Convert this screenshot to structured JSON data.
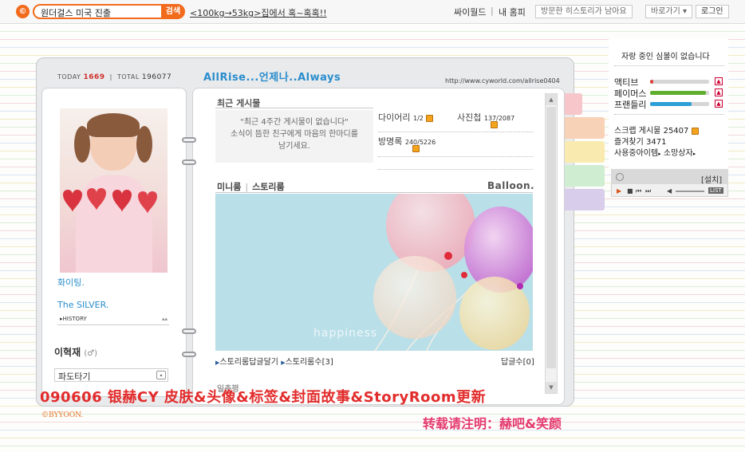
{
  "topbar": {
    "logo_glyph": "©",
    "search_value": "원더걸스 미국 진출",
    "search_button": "검색",
    "promo_link": "<100kg→53kg>집에서 혹~혹혹!!",
    "cyworld_link": "싸이월드",
    "separator": "|",
    "my_home_link": "내 홈피",
    "history_button": "방문한 히스토리가 남아요",
    "shortcut_button": "바로가기 ▾",
    "login_button": "로그인"
  },
  "header": {
    "today_label": "TODAY",
    "today_count": "1669",
    "divider": "|",
    "total_label": "TOTAL",
    "total_count": "196077",
    "title": "AllRise...언제나..Always",
    "url": "http://www.cyworld.com/allrise0404"
  },
  "profile": {
    "mood_line_1": "화이팅.",
    "mood_line_2": "The SILVER.",
    "history_label": "▸HISTORY",
    "history_arrows": "▴▴",
    "owner_name": "이혁재",
    "owner_gender": "(♂)",
    "wave_select": "파도타기",
    "wave_button": "▴"
  },
  "recent": {
    "label": "최근 게시물",
    "empty_line_1": "\"최근 4주간 게시물이 없습니다\"",
    "empty_line_2": "소식이 뜸한 친구에게 마음의 한마디를",
    "empty_line_3": "남기세요."
  },
  "stats": {
    "diary_label": "다이어리",
    "diary_count": "1/2",
    "photo_label": "사진첩",
    "photo_count": "137/2087",
    "guestbook_label": "방명록",
    "guestbook_count": "240/5226"
  },
  "story": {
    "tab_mini": "미니룸",
    "tab_sep": "|",
    "tab_story": "스토리룸",
    "title": "Balloon.",
    "image_caption": "happiness",
    "link_reply": "스토리룸답글달기",
    "link_count": "스토리룸수",
    "link_count_value": "[3]",
    "reply_count_label": "답글수",
    "reply_count_value": "[0]",
    "ilchon_label": "일촌평"
  },
  "scrollbar": {
    "up": "▲",
    "down": "▼"
  },
  "side_panel": {
    "message": "자랑 중인 심볼이 없습니다",
    "active_label": "액티브",
    "famous_label": "페이머스",
    "friendly_label": "프랜들리",
    "active_level": 0.05,
    "famous_level": 0.95,
    "friendly_level": 0.7,
    "up_icon": "▲",
    "scrap_label": "스크랩 게시물",
    "scrap_count": "25407",
    "favorite_label": "즐겨찾기",
    "favorite_count": "3471",
    "items_label": "사용중아이템",
    "wish_label": "소망상자"
  },
  "player": {
    "install_label": "[설치]",
    "play": "▶",
    "stop": "■",
    "prev": "⏮",
    "next": "⏭",
    "volume": "◀",
    "list_label": "LIST"
  },
  "overlay": {
    "title": "090606 银赫CY 皮肤&头像&标签&封面故事&StoryRoom更新",
    "watermark": "©BYYOON.",
    "credit": "转载请注明：赫吧&笑颜"
  },
  "colors": {
    "accent_orange": "#f26a1b",
    "title_blue": "#2a8dcc",
    "overlay_red": "#e22c2c",
    "credit_pink": "#e43a6e",
    "tab_pink": "#f6c6cb",
    "tab_peach": "#f8d2b6",
    "tab_yellow": "#f9ebb0",
    "tab_green": "#cfeed1",
    "tab_lavender": "#d8cdea"
  }
}
